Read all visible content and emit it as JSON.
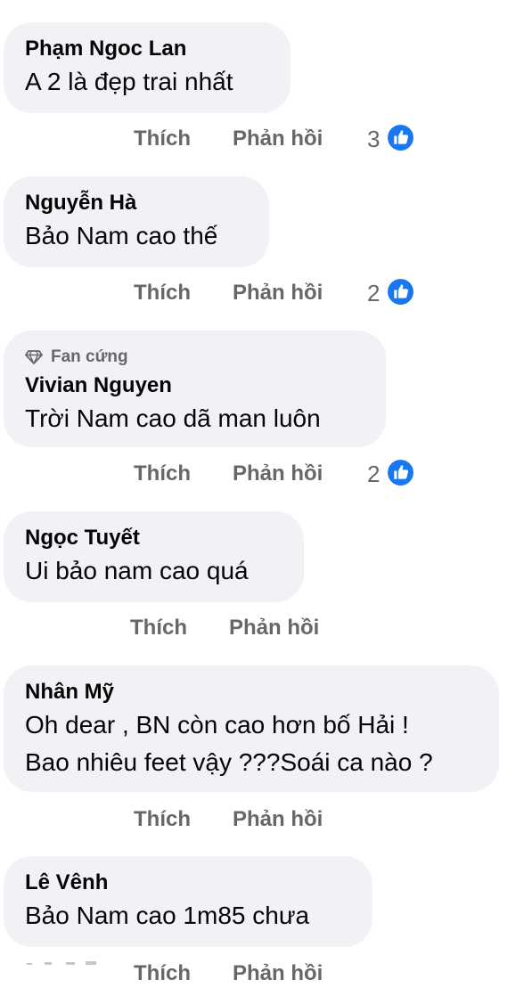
{
  "comments": [
    {
      "author": "Phạm Ngoc Lan",
      "text": [
        "A 2 là đẹp trai nhất"
      ],
      "like": "Thích",
      "reply": "Phản hồi",
      "reactions": "3",
      "reaction_icon": "thumbs-up-icon"
    },
    {
      "author": "Nguyễn Hà",
      "text": [
        "Bảo Nam cao thế"
      ],
      "like": "Thích",
      "reply": "Phản hồi",
      "reactions": "2",
      "reaction_icon": "thumbs-up-icon"
    },
    {
      "badge": "Fan cứng",
      "badge_icon": "diamond-icon",
      "author": "Vivian Nguyen",
      "text": [
        "Trời Nam cao dã man luôn"
      ],
      "like": "Thích",
      "reply": "Phản hồi",
      "reactions": "2",
      "reaction_icon": "thumbs-up-icon"
    },
    {
      "author": "Ngọc Tuyết",
      "text": [
        "Ui bảo nam cao quá"
      ],
      "like": "Thích",
      "reply": "Phản hồi"
    },
    {
      "author": "Nhân Mỹ",
      "text": [
        "Oh dear , BN còn cao hơn bố Hải !",
        "Bao nhiêu feet vậy ???Soái ca nào ?"
      ],
      "like": "Thích",
      "reply": "Phản hồi"
    },
    {
      "author": "Lê Vênh",
      "text": [
        "Bảo Nam cao 1m85 chưa"
      ],
      "like": "Thích",
      "reply": "Phản hồi"
    }
  ],
  "colors": {
    "bubble": "#f0f2f5",
    "text": "#050505",
    "secondary": "#65676b",
    "like_blue": "#1877f2"
  }
}
